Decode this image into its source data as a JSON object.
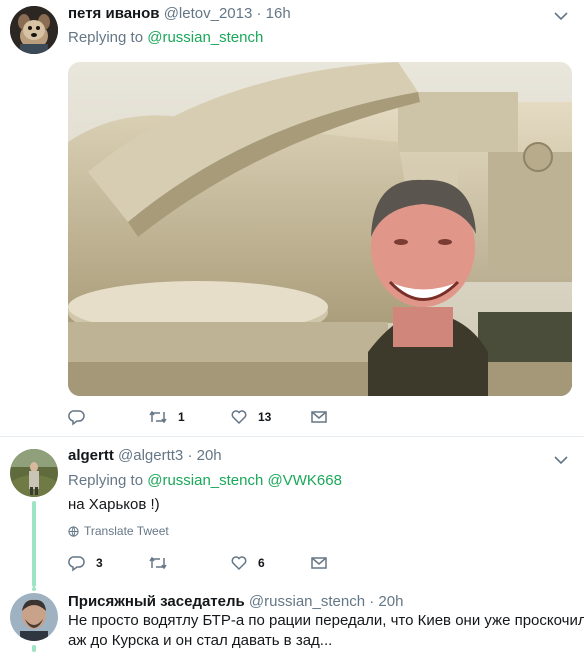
{
  "tweets": [
    {
      "name": "петя иванов",
      "handle": "@letov_2013",
      "time": "16h",
      "replying_to_label": "Replying to",
      "mentions": [
        "@russian_stench"
      ],
      "actions": {
        "reply": "",
        "retweet": "1",
        "like": "13"
      }
    },
    {
      "name": "algertt",
      "handle": "@algertt3",
      "time": "20h",
      "replying_to_label": "Replying to",
      "mentions": [
        "@russian_stench",
        "@VWK668"
      ],
      "text": "на Харьков !)",
      "translate": "Translate Tweet",
      "actions": {
        "reply": "3",
        "retweet": "",
        "like": "6"
      }
    },
    {
      "name": "Присяжный заседатель",
      "handle": "@russian_stench",
      "time": "20h",
      "text_line1": "Не просто водятлу БТР-а по рации передали, что Киев они уже проскочили",
      "text_line2": "аж до Курска и он стал давать в зад..."
    }
  ],
  "separator": " · ",
  "icons": [
    "chevron-down-icon",
    "reply-icon",
    "retweet-icon",
    "like-icon",
    "message-icon",
    "globe-icon"
  ],
  "colors": {
    "mention": "#1aa85a",
    "thread_line": "#9fe3c5",
    "meta": "#657786"
  }
}
